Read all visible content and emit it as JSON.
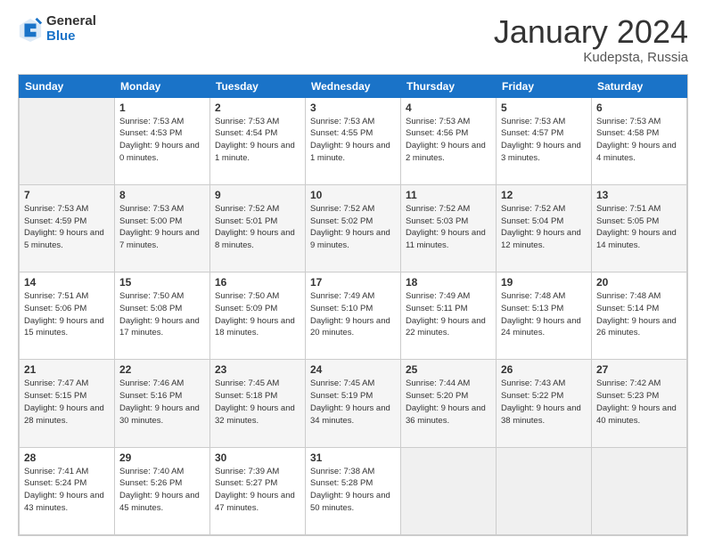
{
  "logo": {
    "general": "General",
    "blue": "Blue"
  },
  "title": {
    "month": "January 2024",
    "location": "Kudepsta, Russia"
  },
  "calendar": {
    "headers": [
      "Sunday",
      "Monday",
      "Tuesday",
      "Wednesday",
      "Thursday",
      "Friday",
      "Saturday"
    ],
    "weeks": [
      [
        {
          "day": "",
          "sunrise": "",
          "sunset": "",
          "daylight": ""
        },
        {
          "day": "1",
          "sunrise": "Sunrise: 7:53 AM",
          "sunset": "Sunset: 4:53 PM",
          "daylight": "Daylight: 9 hours and 0 minutes."
        },
        {
          "day": "2",
          "sunrise": "Sunrise: 7:53 AM",
          "sunset": "Sunset: 4:54 PM",
          "daylight": "Daylight: 9 hours and 1 minute."
        },
        {
          "day": "3",
          "sunrise": "Sunrise: 7:53 AM",
          "sunset": "Sunset: 4:55 PM",
          "daylight": "Daylight: 9 hours and 1 minute."
        },
        {
          "day": "4",
          "sunrise": "Sunrise: 7:53 AM",
          "sunset": "Sunset: 4:56 PM",
          "daylight": "Daylight: 9 hours and 2 minutes."
        },
        {
          "day": "5",
          "sunrise": "Sunrise: 7:53 AM",
          "sunset": "Sunset: 4:57 PM",
          "daylight": "Daylight: 9 hours and 3 minutes."
        },
        {
          "day": "6",
          "sunrise": "Sunrise: 7:53 AM",
          "sunset": "Sunset: 4:58 PM",
          "daylight": "Daylight: 9 hours and 4 minutes."
        }
      ],
      [
        {
          "day": "7",
          "sunrise": "Sunrise: 7:53 AM",
          "sunset": "Sunset: 4:59 PM",
          "daylight": "Daylight: 9 hours and 5 minutes."
        },
        {
          "day": "8",
          "sunrise": "Sunrise: 7:53 AM",
          "sunset": "Sunset: 5:00 PM",
          "daylight": "Daylight: 9 hours and 7 minutes."
        },
        {
          "day": "9",
          "sunrise": "Sunrise: 7:52 AM",
          "sunset": "Sunset: 5:01 PM",
          "daylight": "Daylight: 9 hours and 8 minutes."
        },
        {
          "day": "10",
          "sunrise": "Sunrise: 7:52 AM",
          "sunset": "Sunset: 5:02 PM",
          "daylight": "Daylight: 9 hours and 9 minutes."
        },
        {
          "day": "11",
          "sunrise": "Sunrise: 7:52 AM",
          "sunset": "Sunset: 5:03 PM",
          "daylight": "Daylight: 9 hours and 11 minutes."
        },
        {
          "day": "12",
          "sunrise": "Sunrise: 7:52 AM",
          "sunset": "Sunset: 5:04 PM",
          "daylight": "Daylight: 9 hours and 12 minutes."
        },
        {
          "day": "13",
          "sunrise": "Sunrise: 7:51 AM",
          "sunset": "Sunset: 5:05 PM",
          "daylight": "Daylight: 9 hours and 14 minutes."
        }
      ],
      [
        {
          "day": "14",
          "sunrise": "Sunrise: 7:51 AM",
          "sunset": "Sunset: 5:06 PM",
          "daylight": "Daylight: 9 hours and 15 minutes."
        },
        {
          "day": "15",
          "sunrise": "Sunrise: 7:50 AM",
          "sunset": "Sunset: 5:08 PM",
          "daylight": "Daylight: 9 hours and 17 minutes."
        },
        {
          "day": "16",
          "sunrise": "Sunrise: 7:50 AM",
          "sunset": "Sunset: 5:09 PM",
          "daylight": "Daylight: 9 hours and 18 minutes."
        },
        {
          "day": "17",
          "sunrise": "Sunrise: 7:49 AM",
          "sunset": "Sunset: 5:10 PM",
          "daylight": "Daylight: 9 hours and 20 minutes."
        },
        {
          "day": "18",
          "sunrise": "Sunrise: 7:49 AM",
          "sunset": "Sunset: 5:11 PM",
          "daylight": "Daylight: 9 hours and 22 minutes."
        },
        {
          "day": "19",
          "sunrise": "Sunrise: 7:48 AM",
          "sunset": "Sunset: 5:13 PM",
          "daylight": "Daylight: 9 hours and 24 minutes."
        },
        {
          "day": "20",
          "sunrise": "Sunrise: 7:48 AM",
          "sunset": "Sunset: 5:14 PM",
          "daylight": "Daylight: 9 hours and 26 minutes."
        }
      ],
      [
        {
          "day": "21",
          "sunrise": "Sunrise: 7:47 AM",
          "sunset": "Sunset: 5:15 PM",
          "daylight": "Daylight: 9 hours and 28 minutes."
        },
        {
          "day": "22",
          "sunrise": "Sunrise: 7:46 AM",
          "sunset": "Sunset: 5:16 PM",
          "daylight": "Daylight: 9 hours and 30 minutes."
        },
        {
          "day": "23",
          "sunrise": "Sunrise: 7:45 AM",
          "sunset": "Sunset: 5:18 PM",
          "daylight": "Daylight: 9 hours and 32 minutes."
        },
        {
          "day": "24",
          "sunrise": "Sunrise: 7:45 AM",
          "sunset": "Sunset: 5:19 PM",
          "daylight": "Daylight: 9 hours and 34 minutes."
        },
        {
          "day": "25",
          "sunrise": "Sunrise: 7:44 AM",
          "sunset": "Sunset: 5:20 PM",
          "daylight": "Daylight: 9 hours and 36 minutes."
        },
        {
          "day": "26",
          "sunrise": "Sunrise: 7:43 AM",
          "sunset": "Sunset: 5:22 PM",
          "daylight": "Daylight: 9 hours and 38 minutes."
        },
        {
          "day": "27",
          "sunrise": "Sunrise: 7:42 AM",
          "sunset": "Sunset: 5:23 PM",
          "daylight": "Daylight: 9 hours and 40 minutes."
        }
      ],
      [
        {
          "day": "28",
          "sunrise": "Sunrise: 7:41 AM",
          "sunset": "Sunset: 5:24 PM",
          "daylight": "Daylight: 9 hours and 43 minutes."
        },
        {
          "day": "29",
          "sunrise": "Sunrise: 7:40 AM",
          "sunset": "Sunset: 5:26 PM",
          "daylight": "Daylight: 9 hours and 45 minutes."
        },
        {
          "day": "30",
          "sunrise": "Sunrise: 7:39 AM",
          "sunset": "Sunset: 5:27 PM",
          "daylight": "Daylight: 9 hours and 47 minutes."
        },
        {
          "day": "31",
          "sunrise": "Sunrise: 7:38 AM",
          "sunset": "Sunset: 5:28 PM",
          "daylight": "Daylight: 9 hours and 50 minutes."
        },
        {
          "day": "",
          "sunrise": "",
          "sunset": "",
          "daylight": ""
        },
        {
          "day": "",
          "sunrise": "",
          "sunset": "",
          "daylight": ""
        },
        {
          "day": "",
          "sunrise": "",
          "sunset": "",
          "daylight": ""
        }
      ]
    ]
  }
}
